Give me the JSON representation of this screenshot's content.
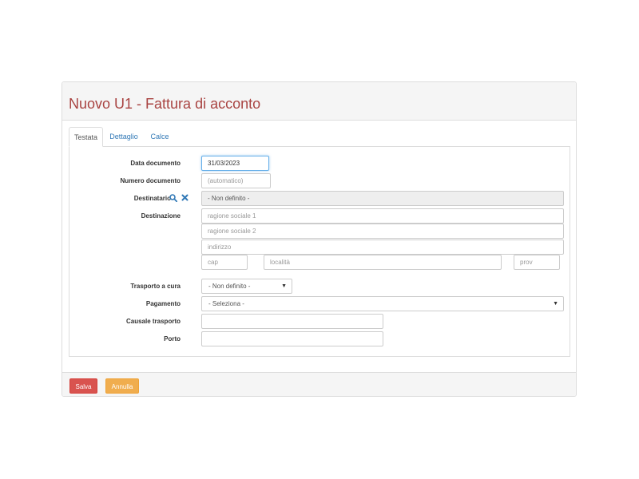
{
  "header": {
    "title": "Nuovo U1 - Fattura di acconto"
  },
  "tabs": [
    {
      "label": "Testata"
    },
    {
      "label": "Dettaglio"
    },
    {
      "label": "Calce"
    }
  ],
  "form": {
    "data_documento": {
      "label": "Data documento",
      "value": "31/03/2023"
    },
    "numero_documento": {
      "label": "Numero documento",
      "placeholder": "(automatico)"
    },
    "destinatario": {
      "label": "Destinatario",
      "value": "- Non definito -",
      "search_icon": "search-icon",
      "clear_icon": "close-icon"
    },
    "destinazione": {
      "label": "Destinazione",
      "ragione_sociale_1": "ragione sociale 1",
      "ragione_sociale_2": "ragione sociale 2",
      "indirizzo": "indirizzo",
      "cap": "cap",
      "localita": "località",
      "prov": "prov"
    },
    "trasporto": {
      "label": "Trasporto a cura",
      "value": "- Non definito -"
    },
    "pagamento": {
      "label": "Pagamento",
      "value": "- Seleziona -"
    },
    "causale_trasporto": {
      "label": "Causale trasporto",
      "value": ""
    },
    "porto": {
      "label": "Porto",
      "value": ""
    }
  },
  "footer": {
    "save_label": "Salva",
    "cancel_label": "Annulla"
  },
  "colors": {
    "title": "#a94442",
    "link": "#337ab7",
    "save": "#d9534f",
    "cancel": "#f0ad4e"
  }
}
